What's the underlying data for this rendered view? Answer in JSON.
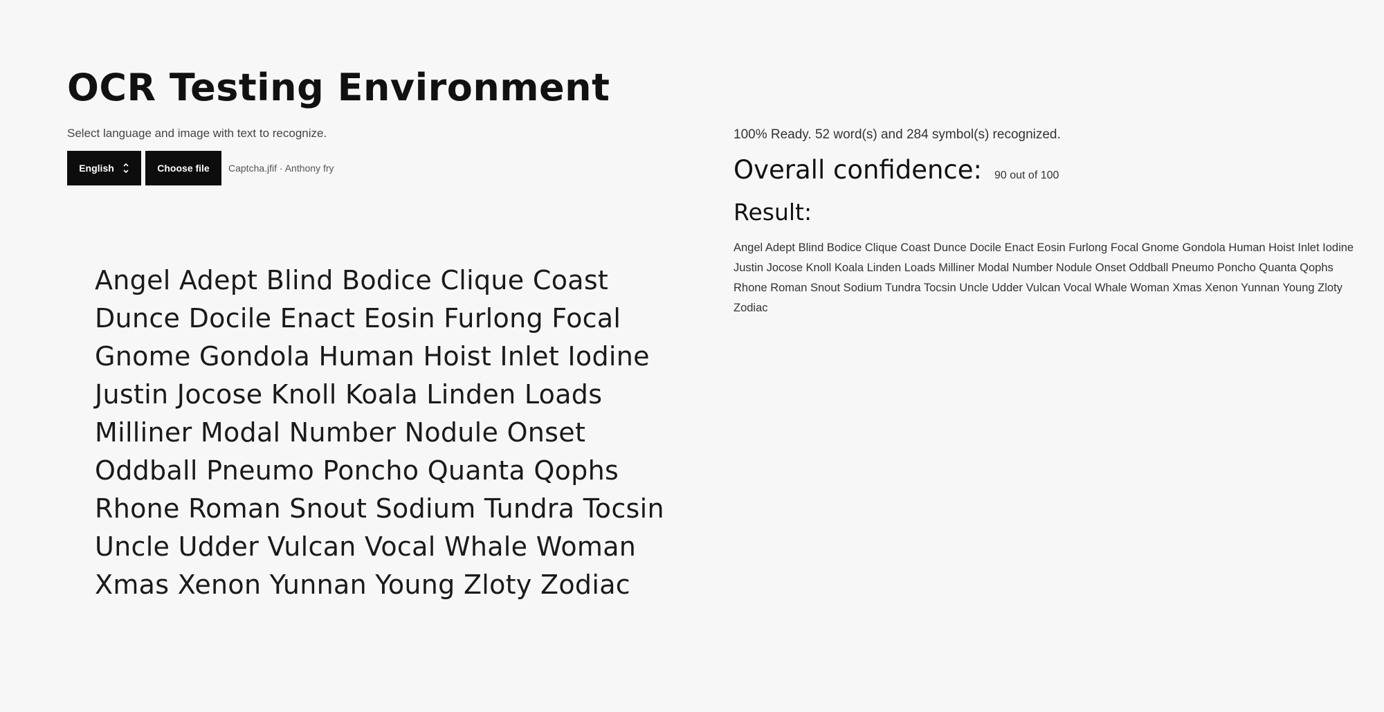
{
  "page": {
    "title": "OCR Testing Environment",
    "subtitle": "Select language and image with text to recognize."
  },
  "controls": {
    "language": "English",
    "language_icon": "chevron-down-icon",
    "choose_label": "Choose file",
    "file_name": "Captcha.jfif · Anthony fry"
  },
  "sample": {
    "lines": [
      "Angel Adept Blind Bodice Clique Coast",
      "Dunce Docile Enact Eosin Furlong Focal",
      "Gnome Gondola Human Hoist Inlet Iodine",
      "Justin Jocose Knoll Koala Linden Loads",
      "Milliner Modal Number Nodule Onset",
      "Oddball Pneumo Poncho Quanta Qophs",
      "Rhone Roman Snout Sodium Tundra Tocsin",
      "Uncle Udder Vulcan Vocal Whale Woman",
      "Xmas Xenon Yunnan Young Zloty Zodiac"
    ]
  },
  "results": {
    "status": "100%  Ready. 52 word(s) and 284 symbol(s) recognized.",
    "confidence_label": "Overall confidence:",
    "confidence_value": "90 out of 100",
    "result_label": "Result:",
    "result_text": "Angel Adept Blind Bodice Clique Coast Dunce Docile Enact Eosin Furlong Focal Gnome Gondola Human Hoist Inlet Iodine Justin Jocose Knoll Koala Linden Loads Milliner Modal Number Nodule Onset Oddball Pneumo Poncho Quanta Qophs Rhone Roman Snout Sodium Tundra Tocsin Uncle Udder Vulcan Vocal Whale Woman Xmas Xenon Yunnan Young Zloty Zodiac"
  },
  "colors": {
    "background": "#f7f7f7",
    "button": "#0d0d0d",
    "text": "#111111"
  }
}
